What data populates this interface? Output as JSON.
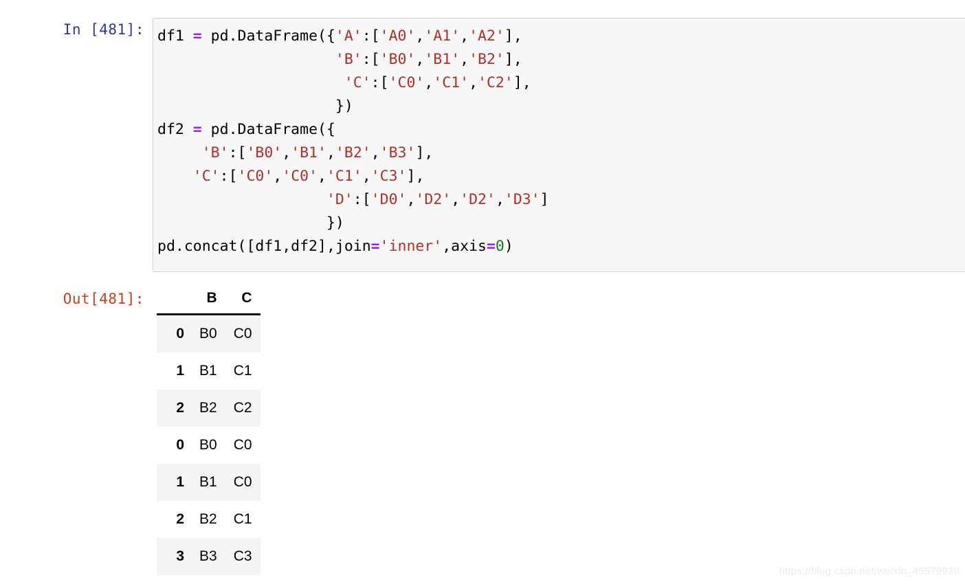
{
  "cell": {
    "input_prompt": "In [481]:",
    "output_prompt": "Out[481]:",
    "code_lines": [
      [
        {
          "t": "df1 = pd.DataFrame({",
          "k": "plain_with_op"
        },
        {
          "t": "'A'",
          "k": "str"
        },
        {
          "t": ":[",
          "k": "plain"
        },
        {
          "t": "'A0'",
          "k": "str"
        },
        {
          "t": ",",
          "k": "plain"
        },
        {
          "t": "'A1'",
          "k": "str"
        },
        {
          "t": ",",
          "k": "plain"
        },
        {
          "t": "'A2'",
          "k": "str"
        },
        {
          "t": "],",
          "k": "plain"
        }
      ]
    ],
    "code_text": "df1 = pd.DataFrame({'A':['A0','A1','A2'],\n                    'B':['B0','B1','B2'],\n                     'C':['C0','C1','C2'],\n                    })\ndf2 = pd.DataFrame({\n     'B':['B0','B1','B2','B3'],\n    'C':['C0','C0','C1','C3'],\n                   'D':['D0','D2','D2','D3']\n                   })\npd.concat([df1,df2],join='inner',axis=0)"
  },
  "table": {
    "index_header": "",
    "columns": [
      "B",
      "C"
    ],
    "index": [
      "0",
      "1",
      "2",
      "0",
      "1",
      "2",
      "3"
    ],
    "rows": [
      [
        "B0",
        "C0"
      ],
      [
        "B1",
        "C1"
      ],
      [
        "B2",
        "C2"
      ],
      [
        "B0",
        "C0"
      ],
      [
        "B1",
        "C0"
      ],
      [
        "B2",
        "C1"
      ],
      [
        "B3",
        "C3"
      ]
    ]
  },
  "watermark": {
    "text": "https://blog.csdn.net/weixin_45579930"
  },
  "colors": {
    "in_prompt": "#2a3b8f",
    "out_prompt": "#c7401b",
    "string": "#ae3029",
    "operator": "#a020f0",
    "number": "#1a7d1a",
    "cell_bg": "#f7f7f7",
    "cell_border": "#cfcfcf",
    "stripe": "#f4f4f4"
  }
}
